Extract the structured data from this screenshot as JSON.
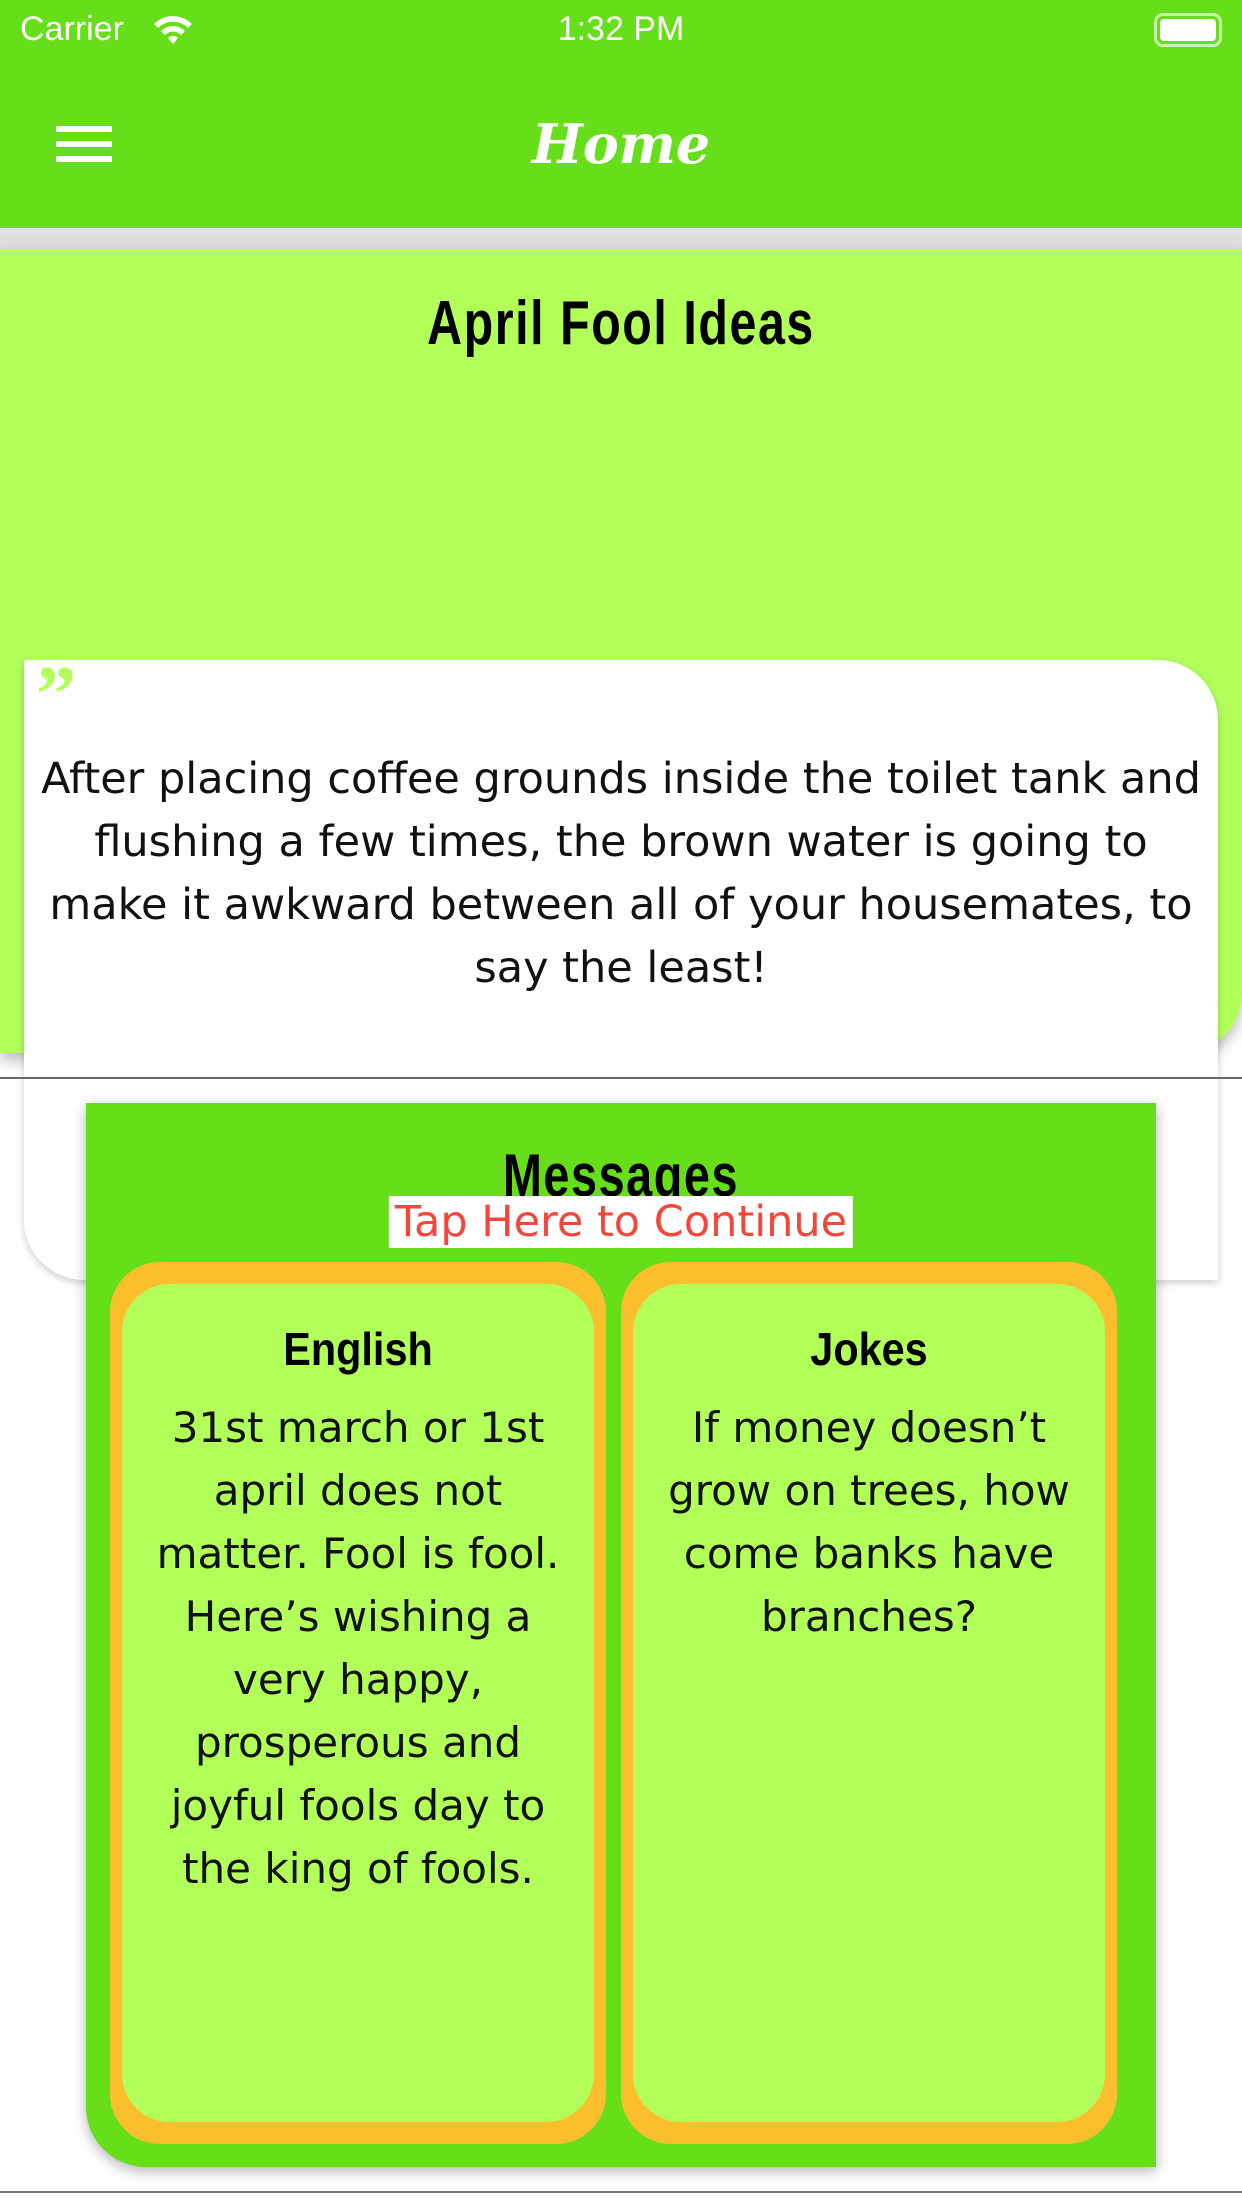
{
  "status_bar": {
    "carrier": "Carrier",
    "time": "1:32 PM"
  },
  "nav": {
    "title": "Home"
  },
  "ideas": {
    "title": "April Fool Ideas",
    "text": "After placing coffee grounds inside the toilet tank and flushing a few times, the brown water is going to make it awkward between all of your housemates, to say the least!",
    "continue_label": "Tap Here to Continue"
  },
  "messages": {
    "title": "Messages",
    "cards": [
      {
        "title": "English",
        "text": "31st march or 1st april does not matter. Fool is fool. Here’s wishing a very happy, prosperous and joyful fools day to the king of fools."
      },
      {
        "title": "Jokes",
        "text": "If money doesn’t grow on trees, how come banks have branches?"
      }
    ]
  },
  "colors": {
    "primary": "#66DF1A",
    "light": "#B2FF59",
    "accent": "#FBBF2E",
    "link": "#F4473A"
  }
}
